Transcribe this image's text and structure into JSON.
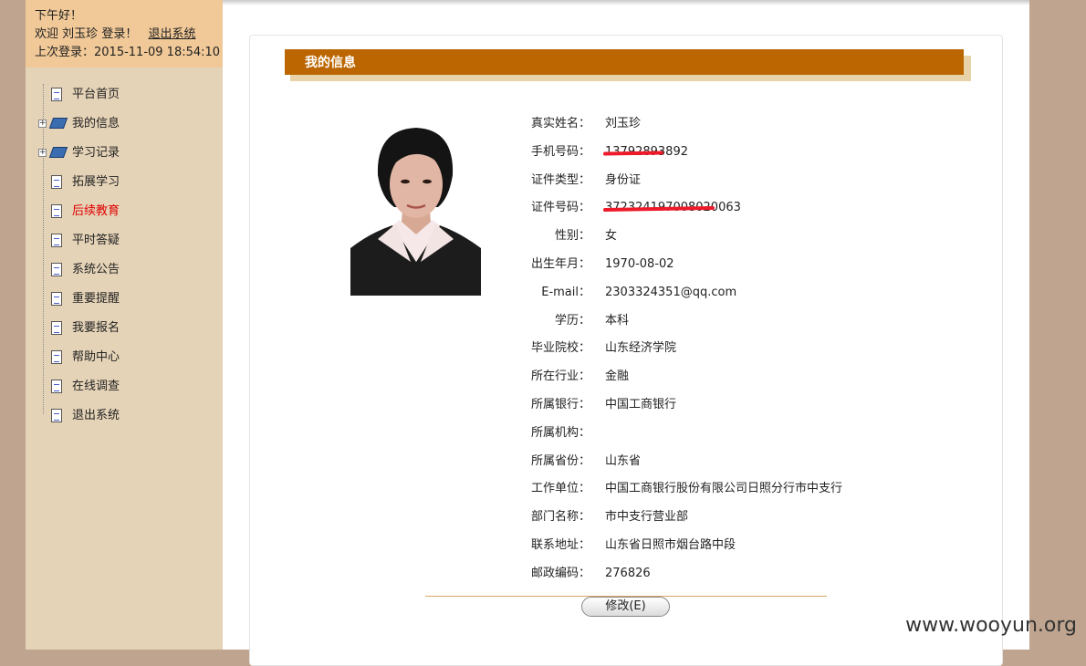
{
  "header": {
    "greeting": "下午好！",
    "welcome_prefix": "欢迎",
    "user_name": "刘玉珍",
    "welcome_suffix": "登录！",
    "logout_link": "退出系统",
    "last_login": "上次登录：2015-11-09 18:54:10"
  },
  "sidebar": {
    "items": [
      {
        "label": "平台首页",
        "icon": "document-icon"
      },
      {
        "label": "我的信息",
        "icon": "book-icon",
        "expandable": true
      },
      {
        "label": "学习记录",
        "icon": "book-icon",
        "expandable": true
      },
      {
        "label": "拓展学习",
        "icon": "document-icon"
      },
      {
        "label": "后续教育",
        "icon": "document-icon",
        "active": true
      },
      {
        "label": "平时答疑",
        "icon": "document-icon"
      },
      {
        "label": "系统公告",
        "icon": "document-icon"
      },
      {
        "label": "重要提醒",
        "icon": "document-icon"
      },
      {
        "label": "我要报名",
        "icon": "document-icon"
      },
      {
        "label": "帮助中心",
        "icon": "document-icon"
      },
      {
        "label": "在线调查",
        "icon": "document-icon"
      },
      {
        "label": "退出系统",
        "icon": "document-icon"
      }
    ]
  },
  "section": {
    "title": "我的信息"
  },
  "profile": [
    {
      "label": "真实姓名：",
      "value": "刘玉珍"
    },
    {
      "label": "手机号码：",
      "value": "13792893892",
      "redacted": true
    },
    {
      "label": "证件类型：",
      "value": "身份证"
    },
    {
      "label": "证件号码：",
      "value": "372324197008020063",
      "redacted": true
    },
    {
      "label": "性别：",
      "value": "女"
    },
    {
      "label": "出生年月：",
      "value": "1970-08-02"
    },
    {
      "label": "E-mail：",
      "value": "2303324351@qq.com"
    },
    {
      "label": "学历：",
      "value": "本科"
    },
    {
      "label": "毕业院校：",
      "value": "山东经济学院"
    },
    {
      "label": "所在行业：",
      "value": "金融"
    },
    {
      "label": "所属银行：",
      "value": "中国工商银行"
    },
    {
      "label": "所属机构：",
      "value": ""
    },
    {
      "label": "所属省份：",
      "value": "山东省"
    },
    {
      "label": "工作单位：",
      "value": "中国工商银行股份有限公司日照分行市中支行"
    },
    {
      "label": "部门名称：",
      "value": "市中支行营业部"
    },
    {
      "label": "联系地址：",
      "value": "山东省日照市烟台路中段"
    },
    {
      "label": "邮政编码：",
      "value": "276826"
    }
  ],
  "actions": {
    "modify_label": "修改(E)"
  },
  "watermark": "www.wooyun.org",
  "colors": {
    "accent": "#bb6600",
    "active_link": "#e00000",
    "sidebar_bg": "#e5d3b7",
    "redaction": "#ee1a2a"
  }
}
